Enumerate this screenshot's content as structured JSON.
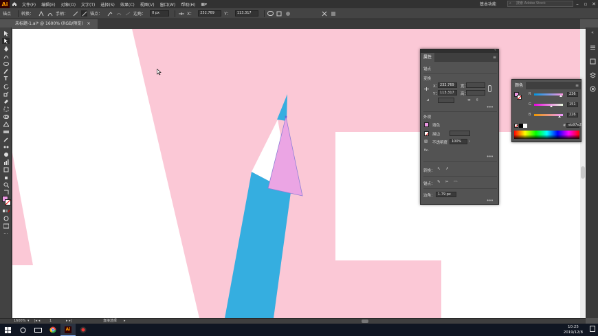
{
  "app": {
    "logo": "Ai",
    "menus": [
      "文件(F)",
      "编辑(E)",
      "对象(O)",
      "文字(T)",
      "选择(S)",
      "效果(C)",
      "视图(V)",
      "窗口(W)",
      "帮助(H)"
    ],
    "workspace": "基本功能",
    "search_placeholder": "搜索 Adobe Stock"
  },
  "controlbar": {
    "anchor_label": "锚点",
    "convert_label": "转换：",
    "handle_label": "手柄：",
    "anchor2_label": "锚点：",
    "corner_label": "边角：",
    "corner_value": "0 px",
    "x_label": "X：",
    "x_value": "232.769",
    "y_label": "Y：",
    "y_value": "113.317"
  },
  "document": {
    "tab_title": "未标题-1.ai* @ 1600% (RGB/预览)",
    "tab_close": "×"
  },
  "properties": {
    "title": "属性",
    "section_anchor": "锚点",
    "section_transform": "变换",
    "x_label": "X：",
    "x_value": "232.769",
    "y_label": "Y：",
    "y_value": "113.317",
    "w_label": "宽：",
    "h_label": "高：",
    "section_appearance": "外观",
    "fill_label": "填色",
    "stroke_label": "描边",
    "opacity_label": "不透明度",
    "opacity_value": "100%",
    "fx_label": "fx.",
    "convert_label": "转换：",
    "anchor_label": "锚点：",
    "corner_label": "边角：",
    "corner_value": "1.79 px",
    "more": "•••"
  },
  "color_panel": {
    "title": "颜色",
    "r_label": "R",
    "r_value": "236",
    "g_label": "G",
    "g_value": "151",
    "b_label": "B",
    "b_value": "226",
    "hex_label": "#",
    "hex_value": "eb97e2",
    "r_level": 0.925,
    "g_level": 0.592,
    "b_level": 0.886
  },
  "status": {
    "zoom": "1600%",
    "artboard_index": "1",
    "tool_name": "直接选择"
  },
  "taskbar": {
    "time": "10:25",
    "date": "2019/12/8"
  },
  "colors": {
    "pink_bg": "#fbc8d6",
    "blue_shape": "#35aee0",
    "lilac_shape": "#eba5e4",
    "fill_swatch": "#eb97e2"
  }
}
